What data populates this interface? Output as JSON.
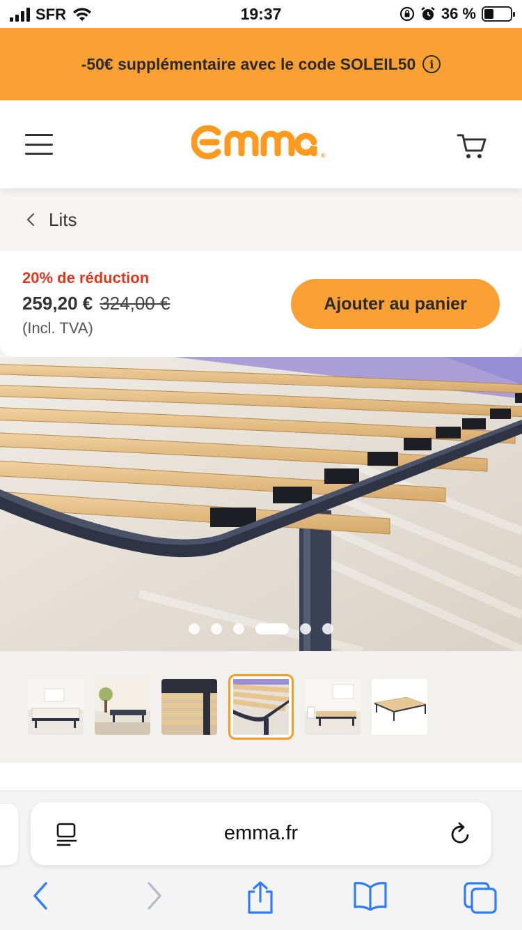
{
  "status_bar": {
    "carrier": "SFR",
    "time": "19:37",
    "battery": "36 %",
    "battery_level": 0.36
  },
  "promo": {
    "text": "-50€ supplémentaire avec le code SOLEIL50",
    "icon": "info-icon"
  },
  "header": {
    "logo": "Emma",
    "logo_color": "#fb9a1e",
    "menu_icon": "hamburger-icon",
    "cart_icon": "cart-icon"
  },
  "breadcrumb": {
    "label": "Lits"
  },
  "price": {
    "discount": "20% de réduction",
    "current": "259,20 €",
    "original": "324,00 €",
    "vat": "(Incl. TVA)",
    "cta": "Ajouter au panier",
    "accent": "#fba035",
    "discount_color": "#d93a1f"
  },
  "gallery": {
    "slide_count": 6,
    "active_index": 3,
    "thumbnail_count": 6
  },
  "browser": {
    "url": "emma.fr",
    "accent": "#2f7cf6"
  }
}
